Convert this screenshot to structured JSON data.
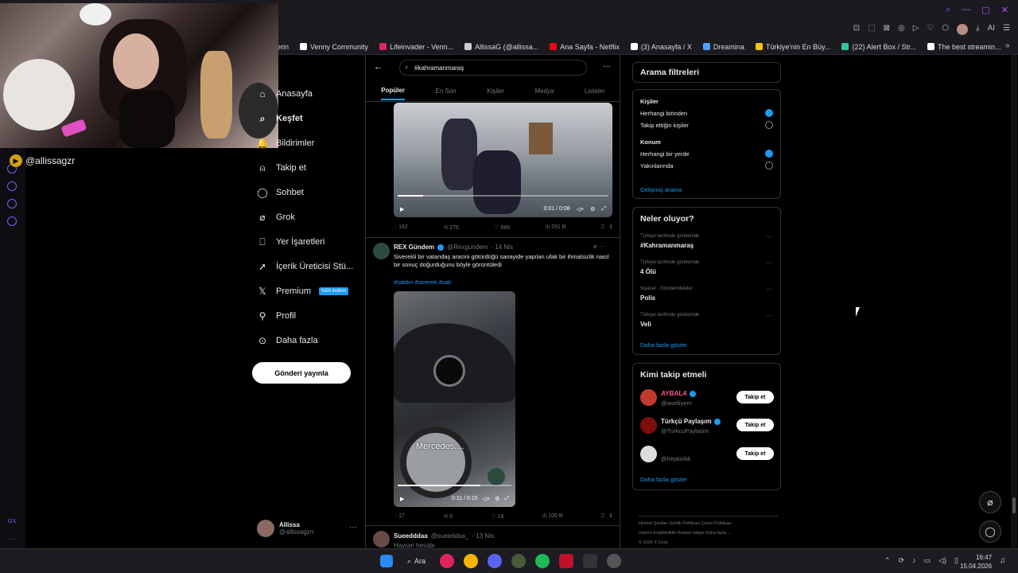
{
  "bookmarks": [
    {
      "label": "erin",
      "color": "#888"
    },
    {
      "label": "Venny Community",
      "color": "#ffffff"
    },
    {
      "label": "Lifeinvader - Venn...",
      "color": "#e0245e"
    },
    {
      "label": "AllissaG (@allissa...",
      "color": "#cccccc"
    },
    {
      "label": "Ana Sayfa - Netflix",
      "color": "#e50914"
    },
    {
      "label": "(3) Anasayfa / X",
      "color": "#ffffff"
    },
    {
      "label": "Dreamina",
      "color": "#4da3ff"
    },
    {
      "label": "Türkiye'nin En Büy...",
      "color": "#f5c518"
    },
    {
      "label": "(22) Alert Box / Str...",
      "color": "#31c3a2"
    },
    {
      "label": "The best streamin...",
      "color": "#ffffff"
    }
  ],
  "toolbar": {
    "ai_label": "AI"
  },
  "streamer": {
    "handle": "@allissagzr"
  },
  "nav": {
    "home": "Anasayfa",
    "explore": "Keşfet",
    "notifications": "Bildirimler",
    "follow": "Takip et",
    "chat": "Sohbet",
    "grok": "Grok",
    "bookmarks": "Yer İşaretleri",
    "creator": "İçerik Üreticisi Stü...",
    "premium": "Premium",
    "premium_badge": "%50 indirim",
    "profile": "Profil",
    "more": "Daha fazla",
    "post_button": "Gönderi yayınla"
  },
  "account": {
    "name": "Allissa",
    "handle": "@allissagzrr"
  },
  "search": {
    "query": "#kahramanmaraş"
  },
  "tabs": [
    "Popüler",
    "En Son",
    "Kişiler",
    "Medya",
    "Listeler"
  ],
  "tweet1": {
    "video_time": "0:01 / 0:08",
    "replies": "162",
    "reposts": "276",
    "likes": "685",
    "views": "291 B",
    "progress": 0.12
  },
  "tweet2": {
    "name": "REX Gündem",
    "handle": "@Rexgundem",
    "date": "· 14 Nis",
    "text": "Siverekli bir vatandaş aracini götürdüğü sanayide yapılan ufak bir ihmalsizlik nasıl bir sonuç doğurduğunu böyle görüntüledi",
    "tags": "#saldırı #siverek #salı",
    "video_caption": "Mercedes....",
    "video_time": "0:11 / 0:15",
    "replies": "17",
    "reposts": "5",
    "likes": "18",
    "views": "100 B",
    "progress": 0.73
  },
  "tweet3": {
    "name": "Sueedddaa",
    "handle": "@sueeddaa_",
    "date": "· 13 Nis",
    "text": "Hayran hesabı"
  },
  "filters": {
    "title": "Arama filtreleri",
    "people_head": "Kişiler",
    "people_any": "Herhangi birinden",
    "people_follow": "Takip ettiğin kişiler",
    "loc_head": "Konum",
    "loc_any": "Herhangi bir yerde",
    "loc_near": "Yakınlarında",
    "advanced": "Gelişmiş arama"
  },
  "trends": {
    "title": "Neler oluyor?",
    "items": [
      {
        "category": "Türkiye tarihinde gündemde",
        "name": "#Kahramanmaraş"
      },
      {
        "category": "Türkiye tarihinde gündemde",
        "name": "4 Ölü"
      },
      {
        "category": "Siyaset · Gündemdekiler",
        "name": "Polis"
      },
      {
        "category": "Türkiye tarihinde gündemde",
        "name": "Veli"
      }
    ],
    "more": "Daha fazla göster"
  },
  "who": {
    "title": "Kimi takip etmeli",
    "items": [
      {
        "name": "AYBALA",
        "handle": "@aselliyem",
        "button": "Takip et"
      },
      {
        "name": "Türkçü Paylaşım",
        "handle": "@TurkcuPaylasim",
        "button": "Takip et"
      },
      {
        "name": "",
        "handle": "@hepkirildi",
        "button": "Takip et"
      }
    ],
    "more": "Daha fazla göster"
  },
  "footer": {
    "line1": "Hizmet Şartları   Gizlilik Politikası   Çerez Politikası",
    "line2": "Imprint   Erişilebilirlik   Reklam bilgisi   Daha fazla ...",
    "line3": "© 2026 X Corp."
  },
  "taskbar": {
    "search_label": "Ara",
    "time": "16:47",
    "date": "15.04.2026"
  }
}
